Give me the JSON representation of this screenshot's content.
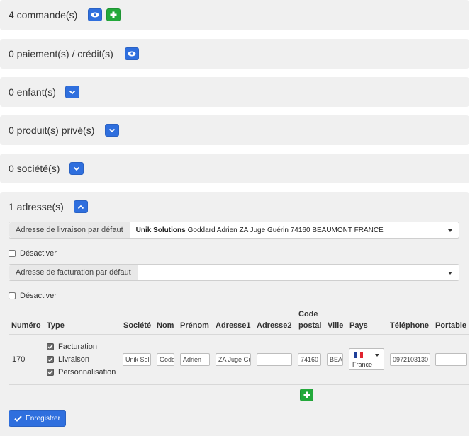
{
  "panels": {
    "orders": {
      "title": "4 commande(s)"
    },
    "payments": {
      "title": "0 paiement(s) / crédit(s)"
    },
    "children": {
      "title": "0 enfant(s)"
    },
    "private_products": {
      "title": "0 produit(s) privé(s)"
    },
    "companies": {
      "title": "0 société(s)"
    },
    "addresses": {
      "title": "1 adresse(s)"
    }
  },
  "addresses": {
    "delivery_default": {
      "label": "Adresse de livraison par défaut",
      "value_bold": "Unik Solutions",
      "value_rest": "Goddard Adrien  ZA Juge Guérin  74160 BEAUMONT  FRANCE"
    },
    "disable_1_label": "Désactiver",
    "billing_default": {
      "label": "Adresse de facturation par défaut",
      "value": ""
    },
    "disable_2_label": "Désactiver",
    "table": {
      "headers": {
        "numero": "Numéro",
        "type": "Type",
        "societe": "Société",
        "nom": "Nom",
        "prenom": "Prénom",
        "adresse1": "Adresse1",
        "adresse2": "Adresse2",
        "code_postal_1": "Code",
        "code_postal_2": "postal",
        "ville": "Ville",
        "pays": "Pays",
        "telephone": "Téléphone",
        "portable": "Portable"
      },
      "row": {
        "numero": "170",
        "types": [
          "Facturation",
          "Livraison",
          "Personnalisation"
        ],
        "societe": "Unik Solutions",
        "nom": "Goddard",
        "prenom": "Adrien",
        "adresse1": "ZA Juge Guérin",
        "adresse2": "",
        "code_postal": "74160",
        "ville": "BEAUMONT",
        "pays": "France",
        "telephone": "0972103130",
        "portable": ""
      }
    },
    "save_label": "Enregistrer"
  },
  "colors": {
    "primary": "#2f6fde",
    "success": "#23a93b",
    "panel_bg": "#f0f0f0"
  },
  "icons": {
    "view": "eye-icon",
    "add": "plus-icon",
    "expand": "chevron-down-icon",
    "collapse": "chevron-up-icon",
    "save": "check-icon"
  }
}
